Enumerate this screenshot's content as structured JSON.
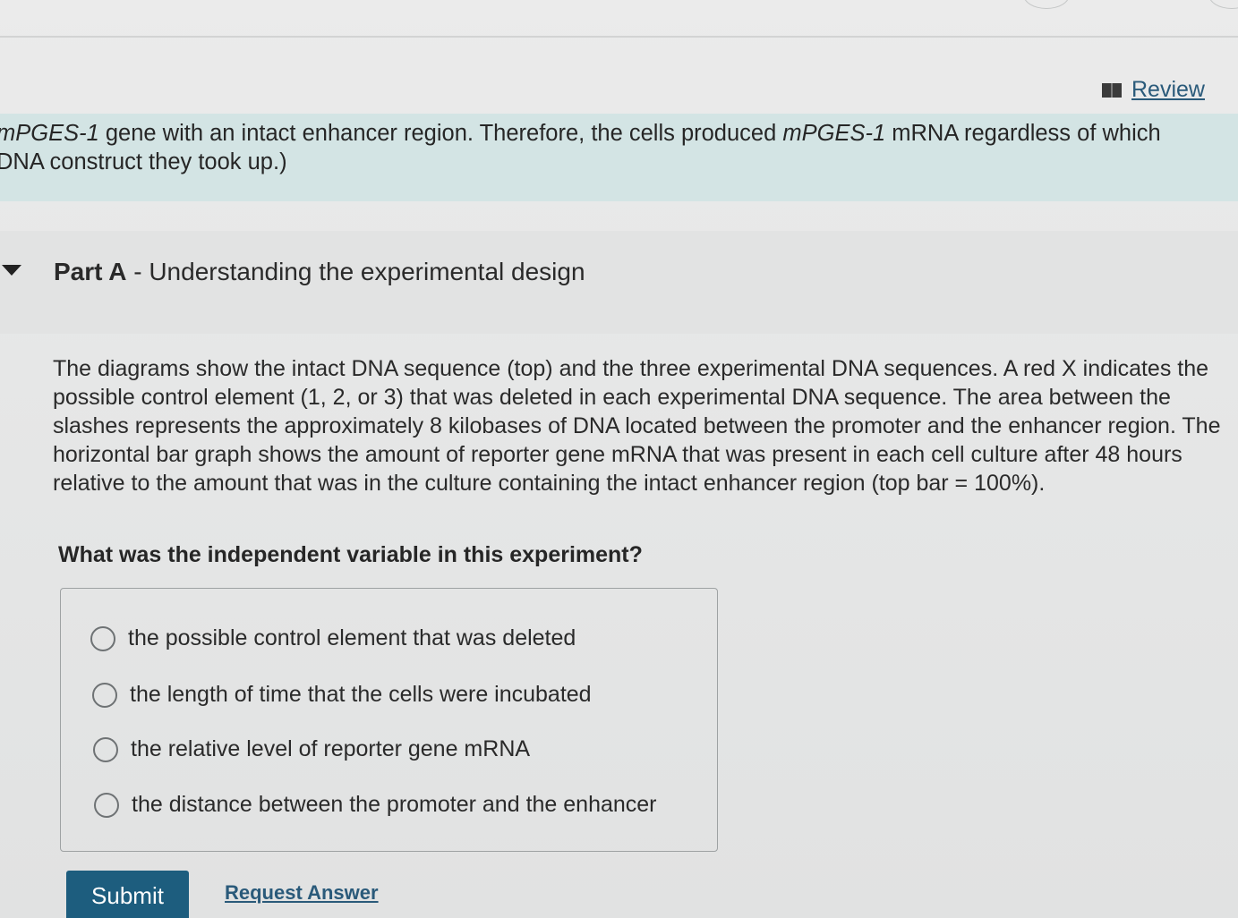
{
  "header": {
    "review_label": "Review"
  },
  "intro": {
    "line1_gene": "mPGES-1",
    "line1_text": " gene with an intact enhancer region. Therefore, the cells produced ",
    "line1_gene2": "mPGES-1",
    "line1_tail": " mRNA regardless of which",
    "line2": "DNA construct they took up.)"
  },
  "part": {
    "label": "Part A",
    "separator": " - ",
    "title": "Understanding the experimental design"
  },
  "description": "The diagrams show the intact DNA sequence (top) and the three experimental DNA sequences. A red X indicates the possible control element (1, 2, or 3) that was deleted in each experimental DNA sequence. The area between the slashes represents the approximately 8 kilobases of DNA located between the promoter and the enhancer region. The horizontal bar graph shows the amount of reporter gene mRNA that was present in each cell culture after 48 hours relative to the amount that was in the culture containing the intact enhancer region (top bar = 100%).",
  "question": "What was the independent variable in this experiment?",
  "options": [
    {
      "label": "the possible control element that was deleted",
      "selected": false
    },
    {
      "label": "the length of time that the cells were incubated",
      "selected": false
    },
    {
      "label": "the relative level of reporter gene mRNA",
      "selected": false
    },
    {
      "label": "the distance between the promoter and the enhancer",
      "selected": false
    }
  ],
  "actions": {
    "submit_label": "Submit",
    "request_label": "Request Answer"
  },
  "colors": {
    "intro_bg": "#d3e4e4",
    "link": "#2a5a7a",
    "submit_bg": "#1d5d7e"
  },
  "icons": {
    "review": "book-icon",
    "part_toggle": "caret-down-icon",
    "radio": "radio-empty-icon"
  }
}
